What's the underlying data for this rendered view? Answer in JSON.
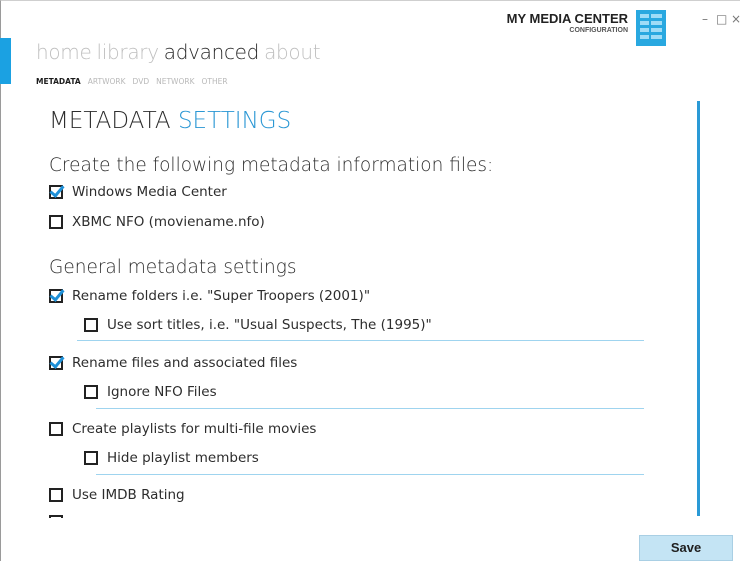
{
  "brand": {
    "title": "MY MEDIA CENTER",
    "subtitle": "CONFIGURATION",
    "accent": "#1ba1e2"
  },
  "window": {
    "minimize": "–",
    "maximize": "□",
    "close": "×"
  },
  "nav": {
    "items": [
      {
        "label": "home",
        "active": false
      },
      {
        "label": "library",
        "active": false
      },
      {
        "label": "advanced",
        "active": true
      },
      {
        "label": "about",
        "active": false
      }
    ]
  },
  "subnav": {
    "items": [
      {
        "label": "METADATA",
        "active": true
      },
      {
        "label": "ARTWORK",
        "active": false
      },
      {
        "label": "DVD",
        "active": false
      },
      {
        "label": "NETWORK",
        "active": false
      },
      {
        "label": "OTHER",
        "active": false
      }
    ]
  },
  "page": {
    "title_main": "METADATA",
    "title_highlight": "SETTINGS",
    "section_files": "Create the following metadata information files:",
    "section_general": "General metadata settings"
  },
  "options": {
    "windows_media_center": {
      "label": "Windows Media Center",
      "checked": true
    },
    "xbmc_nfo": {
      "label": "XBMC NFO (moviename.nfo)",
      "checked": false
    },
    "rename_folders": {
      "label": "Rename folders i.e. \"Super Troopers (2001)\"",
      "checked": true
    },
    "use_sort_titles": {
      "label": "Use sort titles, i.e. \"Usual Suspects, The (1995)\"",
      "checked": false
    },
    "rename_files": {
      "label": "Rename files and associated files",
      "checked": true
    },
    "ignore_nfo": {
      "label": "Ignore NFO Files",
      "checked": false
    },
    "create_playlists": {
      "label": "Create playlists for multi-file movies",
      "checked": false
    },
    "hide_playlist_members": {
      "label": "Hide playlist members",
      "checked": false
    },
    "use_imdb_rating": {
      "label": "Use IMDB Rating",
      "checked": false
    }
  },
  "footer": {
    "save_label": "Save"
  }
}
